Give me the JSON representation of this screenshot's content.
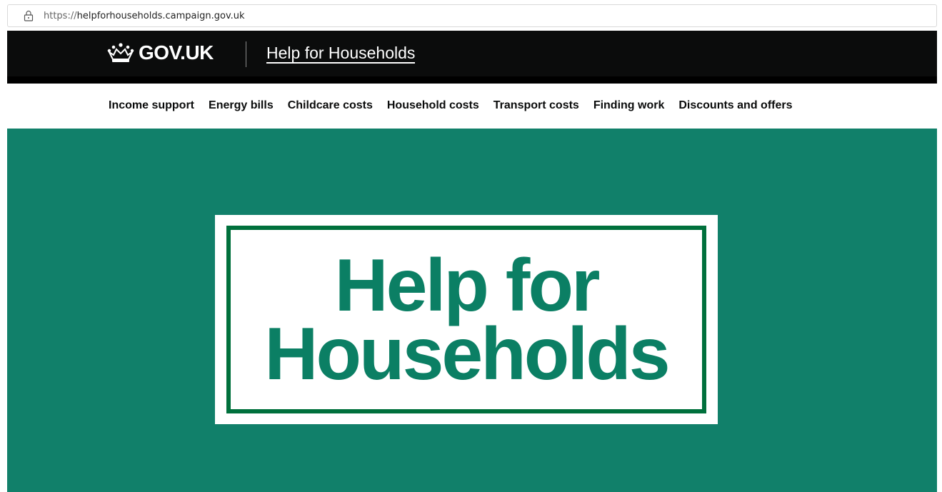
{
  "browser": {
    "url_scheme": "https://",
    "url_host": "helpforhouseholds.campaign.gov.uk"
  },
  "header": {
    "logo_text": "GOV.UK",
    "service_name": "Help for Households"
  },
  "nav": {
    "items": [
      {
        "label": "Income support"
      },
      {
        "label": "Energy bills"
      },
      {
        "label": "Childcare costs"
      },
      {
        "label": "Household costs"
      },
      {
        "label": "Transport costs"
      },
      {
        "label": "Finding work"
      },
      {
        "label": "Discounts and offers"
      }
    ]
  },
  "hero": {
    "line1": "Help for",
    "line2": "Households",
    "background_color": "#11806a",
    "text_color": "#0b7f64"
  }
}
